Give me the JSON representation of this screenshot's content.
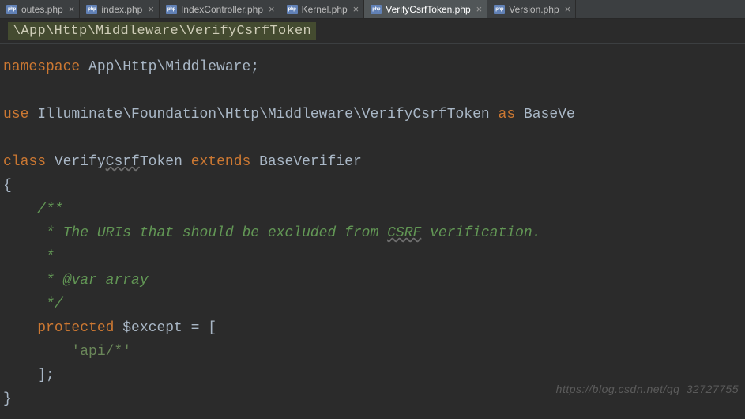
{
  "tabs": [
    {
      "label": "outes.php"
    },
    {
      "label": "index.php"
    },
    {
      "label": "IndexController.php"
    },
    {
      "label": "Kernel.php"
    },
    {
      "label": "VerifyCsrfToken.php"
    },
    {
      "label": "Version.php"
    }
  ],
  "breadcrumb": "\\App\\Http\\Middleware\\VerifyCsrfToken",
  "code": {
    "kw_namespace": "namespace",
    "ns_path": "App\\Http\\Middleware",
    "semi": ";",
    "kw_use": "use",
    "use_path": "Illuminate\\Foundation\\Http\\Middleware\\VerifyCsrfToken",
    "kw_as": "as",
    "alias_partial": "BaseVe",
    "kw_class": "class",
    "class_name_1": "Verify",
    "class_name_2": "Csrf",
    "class_name_3": "Token",
    "kw_extends": "extends",
    "base_class": "BaseVerifier",
    "brace_open": "{",
    "doc_open": "/**",
    "doc_line1_a": " * The URIs that should be excluded from ",
    "doc_line1_csrf": "CSRF",
    "doc_line1_b": " verification.",
    "doc_star": " *",
    "doc_var_tag": "@var",
    "doc_var_type": "array",
    "doc_close": " */",
    "kw_protected": "protected",
    "var_except": "$except",
    "equals_open": " = [",
    "string_api": "'api/*'",
    "close_arr": "];",
    "brace_close": "}"
  },
  "watermark": "https://blog.csdn.net/qq_32727755"
}
